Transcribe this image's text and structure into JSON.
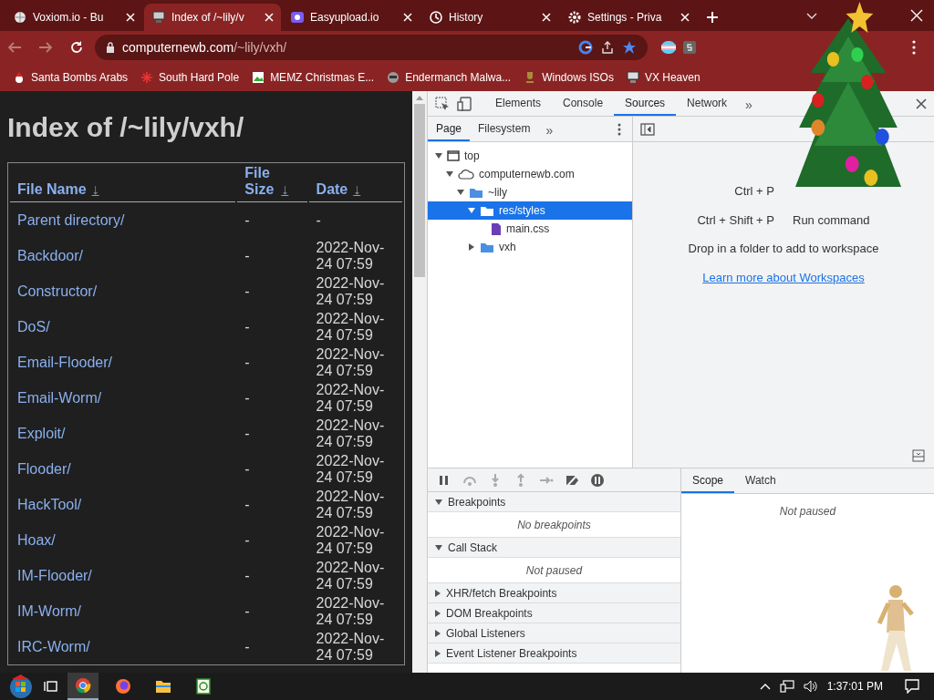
{
  "browser": {
    "tabs": [
      {
        "title": "Voxiom.io - Bu",
        "kind": "site",
        "selected": false
      },
      {
        "title": "Index of /~lily/v",
        "kind": "server",
        "selected": true
      },
      {
        "title": "Easyupload.io",
        "kind": "upload",
        "selected": false
      },
      {
        "title": "History",
        "kind": "history",
        "selected": false
      },
      {
        "title": "Settings - Priva",
        "kind": "settings",
        "selected": false
      }
    ],
    "address": {
      "host": "computernewb.com",
      "path": "/~lily/vxh/"
    },
    "bookmarks": [
      "Santa Bombs Arabs",
      "South Hard Pole",
      "MEMZ Christmas E...",
      "Endermanch Malwa...",
      "Windows ISOs",
      "VX Heaven"
    ]
  },
  "page": {
    "heading": "Index of /~lily/vxh/",
    "columns": [
      "File Name",
      "File Size",
      "Date"
    ],
    "sort_mark": "↓",
    "rows": [
      {
        "name": "Parent directory/",
        "size": "-",
        "date": "-"
      },
      {
        "name": "Backdoor/",
        "size": "-",
        "date": "2022-Nov-24 07:59"
      },
      {
        "name": "Constructor/",
        "size": "-",
        "date": "2022-Nov-24 07:59"
      },
      {
        "name": "DoS/",
        "size": "-",
        "date": "2022-Nov-24 07:59"
      },
      {
        "name": "Email-Flooder/",
        "size": "-",
        "date": "2022-Nov-24 07:59"
      },
      {
        "name": "Email-Worm/",
        "size": "-",
        "date": "2022-Nov-24 07:59"
      },
      {
        "name": "Exploit/",
        "size": "-",
        "date": "2022-Nov-24 07:59"
      },
      {
        "name": "Flooder/",
        "size": "-",
        "date": "2022-Nov-24 07:59"
      },
      {
        "name": "HackTool/",
        "size": "-",
        "date": "2022-Nov-24 07:59"
      },
      {
        "name": "Hoax/",
        "size": "-",
        "date": "2022-Nov-24 07:59"
      },
      {
        "name": "IM-Flooder/",
        "size": "-",
        "date": "2022-Nov-24 07:59"
      },
      {
        "name": "IM-Worm/",
        "size": "-",
        "date": "2022-Nov-24 07:59"
      },
      {
        "name": "IRC-Worm/",
        "size": "-",
        "date": "2022-Nov-24 07:59"
      }
    ]
  },
  "devtools": {
    "tabs": [
      {
        "label": "Elements",
        "selected": false
      },
      {
        "label": "Console",
        "selected": false
      },
      {
        "label": "Sources",
        "selected": true
      },
      {
        "label": "Network",
        "selected": false
      }
    ],
    "more": "»",
    "navigator_tabs": [
      {
        "label": "Page",
        "selected": true
      },
      {
        "label": "Filesystem",
        "selected": false
      }
    ],
    "tree": [
      {
        "label": "top",
        "kind": "frame",
        "expanded": true,
        "selected": false,
        "children": [
          {
            "label": "computernewb.com",
            "kind": "domain",
            "expanded": true,
            "selected": false,
            "children": [
              {
                "label": "~lily",
                "kind": "folder",
                "expanded": true,
                "selected": false,
                "children": [
                  {
                    "label": "res/styles",
                    "kind": "folder",
                    "expanded": true,
                    "selected": true,
                    "children": [
                      {
                        "label": "main.css",
                        "kind": "file",
                        "selected": false
                      }
                    ]
                  },
                  {
                    "label": "vxh",
                    "kind": "folder",
                    "expanded": false,
                    "selected": false
                  }
                ]
              }
            ]
          }
        ]
      }
    ],
    "shortcuts": [
      {
        "keys": "Ctrl + P"
      },
      {
        "keys": "Ctrl + Shift + P",
        "action": "Run command"
      }
    ],
    "hint": "Drop in a folder to add to workspace",
    "link": "Learn more about Workspaces",
    "sections": [
      {
        "title": "Breakpoints",
        "expanded": true,
        "message": "No breakpoints"
      },
      {
        "title": "Call Stack",
        "expanded": true,
        "message": "Not paused"
      },
      {
        "title": "XHR/fetch Breakpoints",
        "expanded": false
      },
      {
        "title": "DOM Breakpoints",
        "expanded": false
      },
      {
        "title": "Global Listeners",
        "expanded": false
      },
      {
        "title": "Event Listener Breakpoints",
        "expanded": false
      }
    ],
    "side_tabs": [
      {
        "label": "Scope",
        "selected": true
      },
      {
        "label": "Watch",
        "selected": false
      }
    ],
    "side_message": "Not paused"
  },
  "taskbar": {
    "apps": [
      {
        "kind": "chrome",
        "selected": true
      },
      {
        "kind": "firefox",
        "selected": false
      },
      {
        "kind": "explorer",
        "selected": false
      },
      {
        "kind": "app",
        "selected": false
      }
    ],
    "clock": "1:37:01 PM"
  }
}
